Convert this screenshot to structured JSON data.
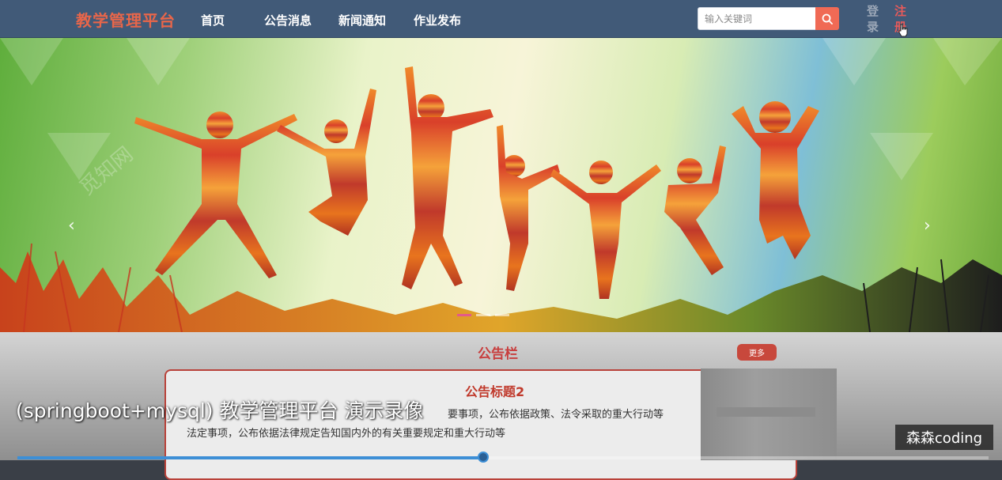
{
  "navbar": {
    "brand": "教学管理平台",
    "links": [
      "首页",
      "公告消息",
      "新闻通知",
      "作业发布"
    ],
    "search": {
      "placeholder": "输入关键词",
      "icon": "search-icon"
    },
    "login": "登录",
    "register": "注册",
    "colors": {
      "bg": "#415a78",
      "brand": "#e8664a",
      "login": "#9aa6b6",
      "register": "#e85a5a",
      "search_btn": "#f06a55"
    }
  },
  "banner": {
    "arrows": {
      "prev": "‹",
      "next": "›"
    },
    "slide_count": 3,
    "active_slide": 0,
    "watermark": "觅知网"
  },
  "notice": {
    "section_title": "公告栏",
    "more_label": "更多",
    "card_title": "公告标题2",
    "text_line1": "要事项，公布依据政策、法令采取的重大行动等",
    "text_line2": "法定事项，公布依据法律规定告知国内外的有关重要规定和重大行动等"
  },
  "video": {
    "caption": "(springboot+mysql) 教学管理平台 演示录像",
    "watermark": "森森coding",
    "progress": 0.48
  }
}
